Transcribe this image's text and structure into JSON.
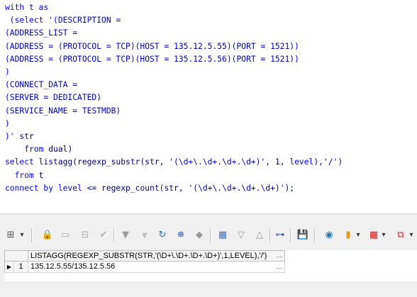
{
  "editor": {
    "lines": [
      [
        {
          "t": "with",
          "c": "kw"
        },
        {
          "t": " t "
        },
        {
          "t": "as",
          "c": "kw"
        }
      ],
      [
        {
          "t": " ("
        },
        {
          "t": "select",
          "c": "kw"
        },
        {
          "t": " '(DESCRIPTION =",
          "c": "str"
        }
      ],
      [
        {
          "t": "(ADDRESS_LIST =",
          "c": "str"
        }
      ],
      [
        {
          "t": "(ADDRESS = (PROTOCOL = TCP)(HOST = 135.12.5.55)(PORT = 1521))",
          "c": "str"
        }
      ],
      [
        {
          "t": "(ADDRESS = (PROTOCOL = TCP)(HOST = 135.12.5.56)(PORT = 1521))",
          "c": "str"
        }
      ],
      [
        {
          "t": ")",
          "c": "str"
        }
      ],
      [
        {
          "t": "(CONNECT_DATA =",
          "c": "str"
        }
      ],
      [
        {
          "t": "(SERVER = DEDICATED)",
          "c": "str"
        }
      ],
      [
        {
          "t": "(SERVICE_NAME = TESTMDB)",
          "c": "str"
        }
      ],
      [
        {
          "t": ")",
          "c": "str"
        }
      ],
      [
        {
          "t": ")'",
          "c": "str"
        },
        {
          "t": " str"
        }
      ],
      [
        {
          "t": "    "
        },
        {
          "t": "from",
          "c": "kw"
        },
        {
          "t": " dual)"
        }
      ],
      [
        {
          "t": "select",
          "c": "kw"
        },
        {
          "t": " listagg(regexp_substr(str, "
        },
        {
          "t": "'(\\d+\\.\\d+.\\d+.\\d+)'",
          "c": "str"
        },
        {
          "t": ", "
        },
        {
          "t": "1",
          "c": "num"
        },
        {
          "t": ", "
        },
        {
          "t": "level",
          "c": "kw"
        },
        {
          "t": "),"
        },
        {
          "t": "'/'",
          "c": "str"
        },
        {
          "t": ")"
        }
      ],
      [
        {
          "t": "  "
        },
        {
          "t": "from",
          "c": "kw"
        },
        {
          "t": " t"
        }
      ],
      [
        {
          "t": "connect by level",
          "c": "kw"
        },
        {
          "t": " <= regexp_count(str, "
        },
        {
          "t": "'(\\d+\\.\\d+.\\d+.\\d+)'",
          "c": "str"
        },
        {
          "t": ");"
        }
      ]
    ]
  },
  "toolbar": {
    "grid_menu_icon": "⊞",
    "dropdown_arrow": "▾",
    "lock_icon": "🔒",
    "new_record_icon": "▭",
    "delete_record_icon": "⊟",
    "post_icon": "✔",
    "filter_icon": "▼",
    "filter_all_icon": "⩔",
    "refresh_icon": "↻",
    "find_icon": "⛯",
    "clear_icon": "◆",
    "single_record_icon": "▦",
    "prior_icon": "▽",
    "next_icon": "△",
    "tree_icon": "⊶",
    "save_icon": "💾",
    "query_icon": "◉",
    "chart_icon": "▮",
    "table_icon": "▦",
    "export_icon": "⧉"
  },
  "results": {
    "header": "LISTAGG(REGEXP_SUBSTR(STR,'(\\D+\\.\\D+.\\D+.\\D+)',1,LEVEL),'/')",
    "header_button": "...",
    "rows": [
      {
        "indicator": "▶",
        "number": "1",
        "value": "135.12.5.55/135.12.5.56",
        "button": "..."
      }
    ]
  },
  "colors": {
    "keyword": "#0000ff",
    "string": "#0000c0",
    "identifier": "#000080"
  }
}
